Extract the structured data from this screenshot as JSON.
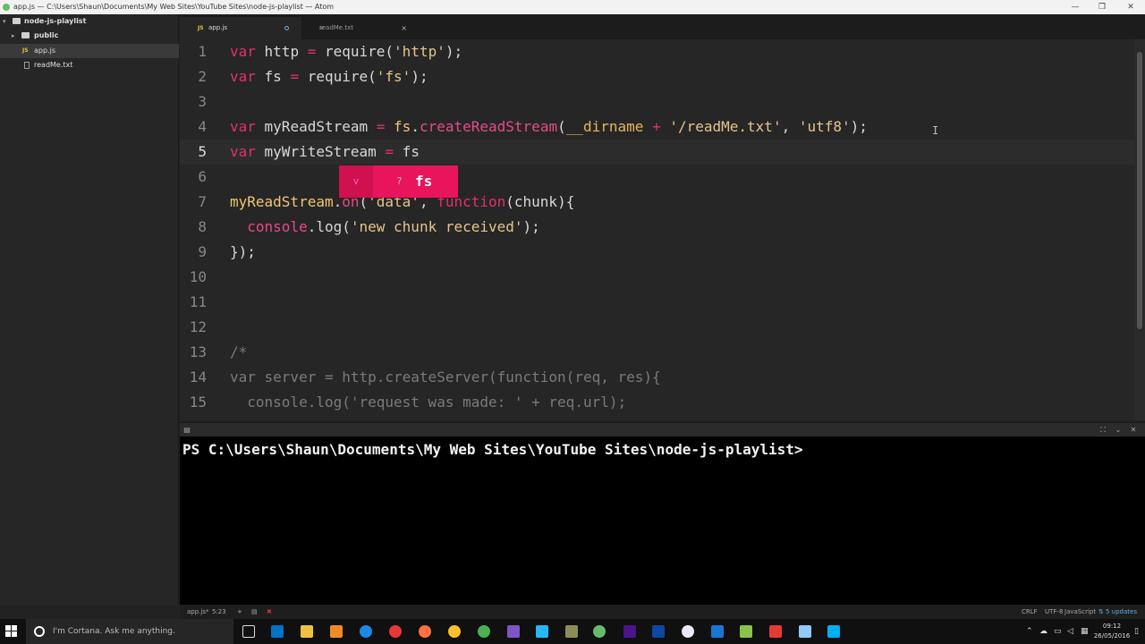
{
  "window": {
    "title": "app.js — C:\\Users\\Shaun\\Documents\\My Web Sites\\YouTube Sites\\node-js-playlist — Atom",
    "minimize": "—",
    "restore": "❐",
    "close": "✕"
  },
  "tree": {
    "root": "node-js-playlist",
    "items": [
      {
        "label": "public",
        "type": "folder"
      },
      {
        "label": "app.js",
        "type": "js"
      },
      {
        "label": "readMe.txt",
        "type": "txt"
      }
    ]
  },
  "tabs": [
    {
      "label": "app.js",
      "modified": true,
      "active": true
    },
    {
      "label": "readMe.txt",
      "modified": false,
      "active": false,
      "close": "×"
    }
  ],
  "editor": {
    "line_numbers": [
      "1",
      "2",
      "3",
      "4",
      "5",
      "6",
      "7",
      "8",
      "9",
      "10",
      "11",
      "12",
      "13",
      "14",
      "15"
    ],
    "cursor_line": 5,
    "autocomplete": {
      "type_glyph": "v",
      "unknown_glyph": "?",
      "suggestion": "fs"
    }
  },
  "terminal": {
    "prompt": "PS C:\\Users\\Shaun\\Documents\\My Web Sites\\YouTube Sites\\node-js-playlist>"
  },
  "statusbar": {
    "file": "app.js*",
    "position": "5:23",
    "line_ending": "CRLF",
    "encoding": "UTF-8",
    "grammar": "JavaScript",
    "updates": "5 updates"
  },
  "taskbar": {
    "search_placeholder": "I'm Cortana. Ask me anything.",
    "time": "09:12",
    "date": "26/05/2016"
  },
  "colors": {
    "accent": "#e8155c",
    "keyword": "#e1306c",
    "string": "#e6c48a"
  }
}
